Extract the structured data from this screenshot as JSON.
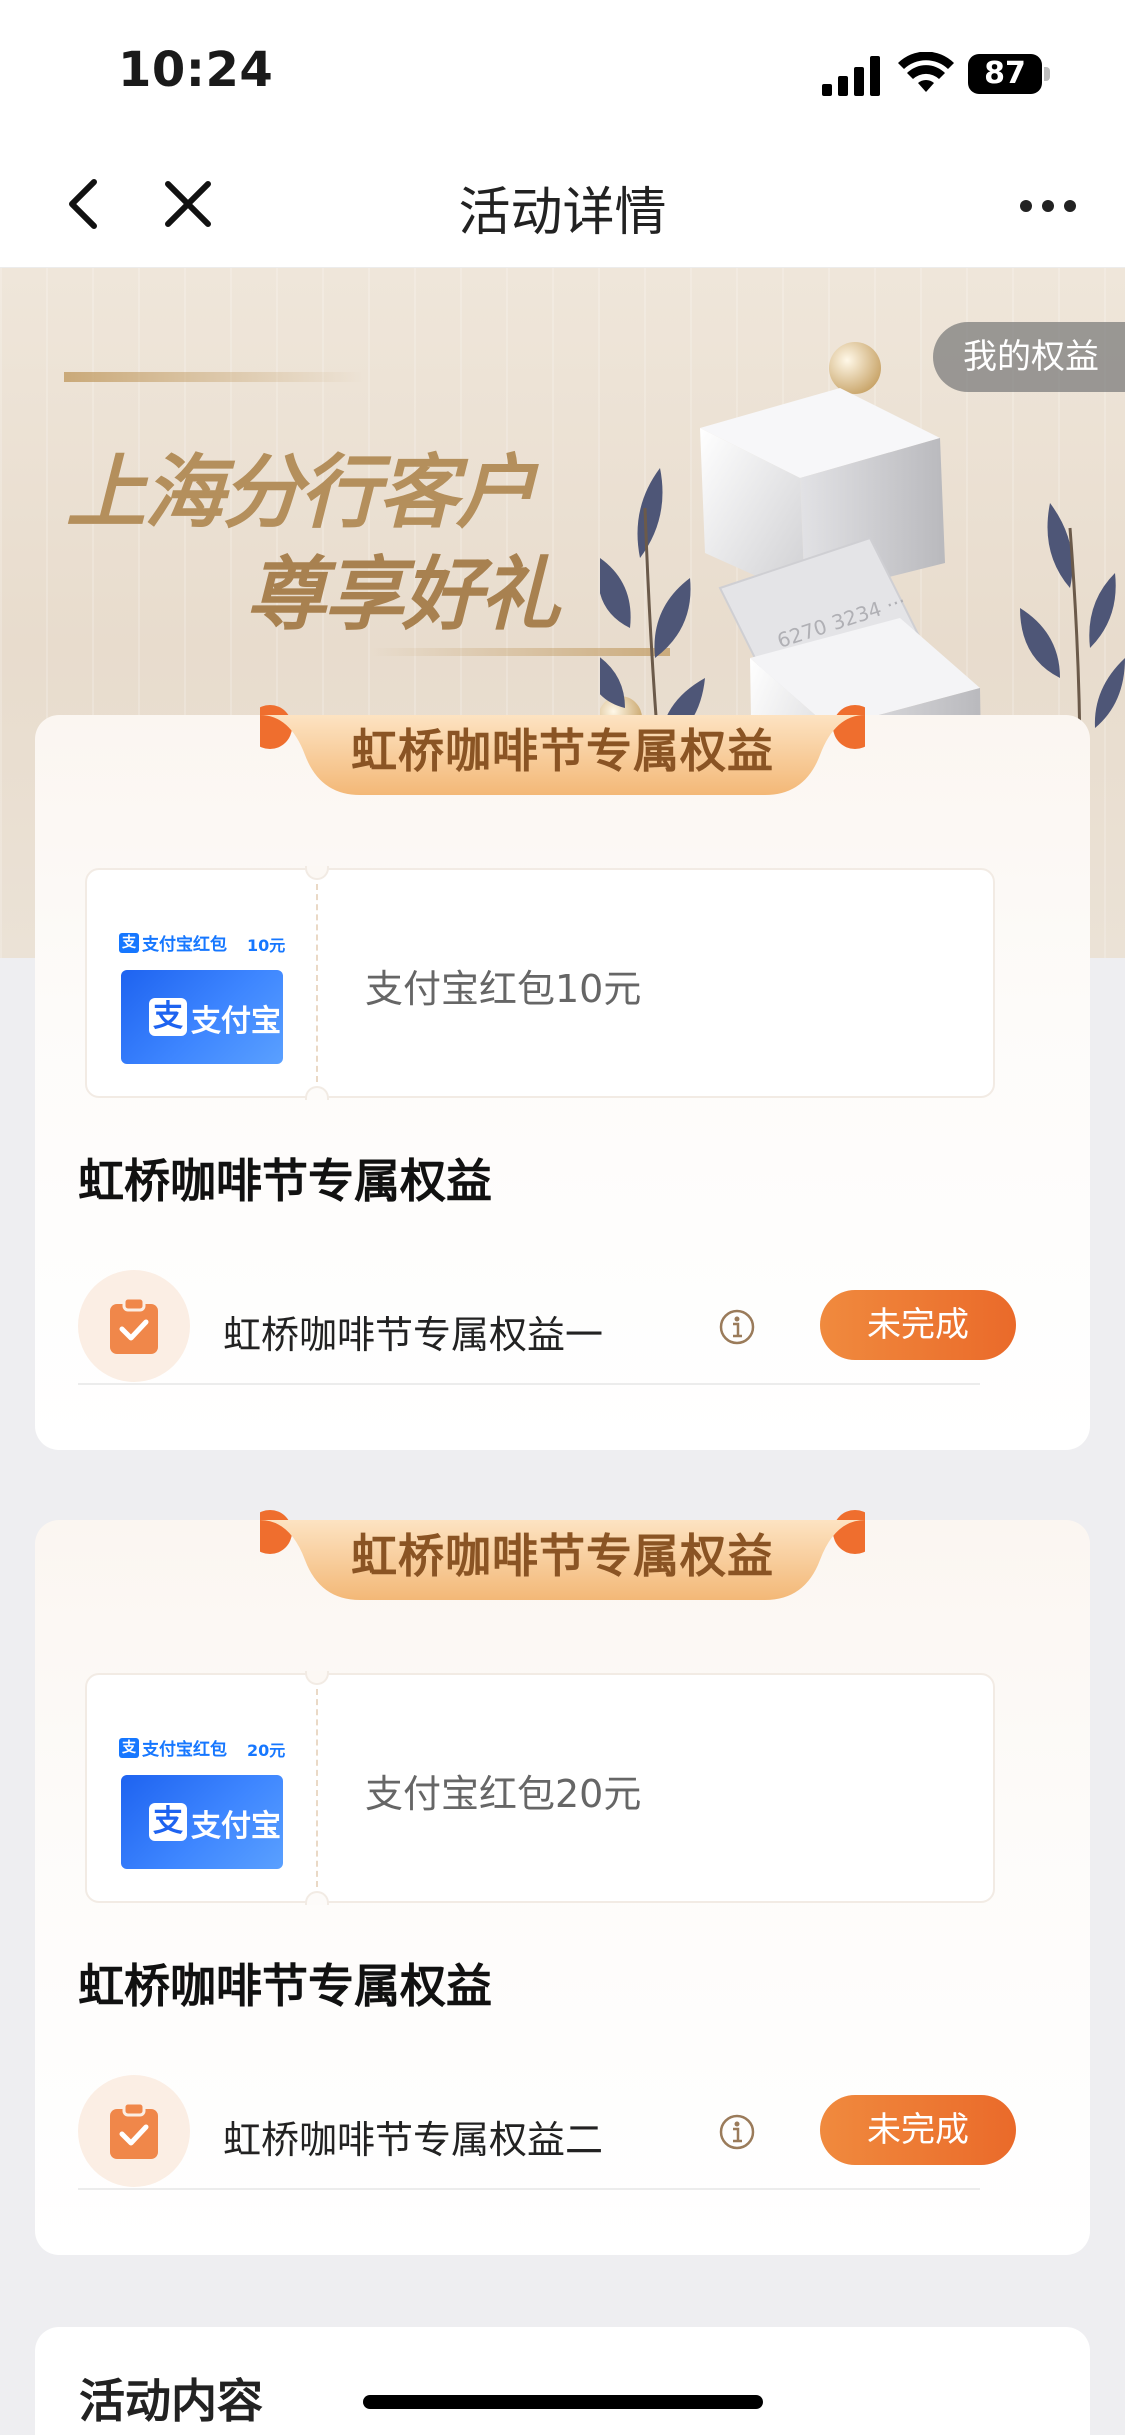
{
  "status_bar": {
    "time": "10:24",
    "battery_level": "87",
    "icons": [
      "cellular-signal-icon",
      "wifi-icon",
      "battery-icon"
    ]
  },
  "nav": {
    "title": "活动详情",
    "icons": [
      "back-icon",
      "close-icon",
      "more-icon"
    ]
  },
  "banner": {
    "headline_1": "上海分行客户",
    "headline_2": "尊享好礼",
    "my_rights_label": "我的权益"
  },
  "benefit_cards": [
    {
      "badge": "虹桥咖啡节专属权益",
      "coupon": {
        "brand_label": "支付宝红包",
        "amount_label": "10元",
        "logo_text": "支付宝",
        "name": "支付宝红包10元"
      },
      "section_title": "虹桥咖啡节专属权益",
      "task": {
        "name": "虹桥咖啡节专属权益一",
        "status": "未完成"
      }
    },
    {
      "badge": "虹桥咖啡节专属权益",
      "coupon": {
        "brand_label": "支付宝红包",
        "amount_label": "20元",
        "logo_text": "支付宝",
        "name": "支付宝红包20元"
      },
      "section_title": "虹桥咖啡节专属权益",
      "task": {
        "name": "虹桥咖啡节专属权益二",
        "status": "未完成"
      }
    }
  ],
  "activity_content": {
    "title": "活动内容"
  },
  "colors": {
    "accent_orange": "#ea6a2a",
    "badge_gold": "#f3c58f",
    "alipay_blue": "#1677ff",
    "banner_gold_text": "#b48f5c"
  }
}
